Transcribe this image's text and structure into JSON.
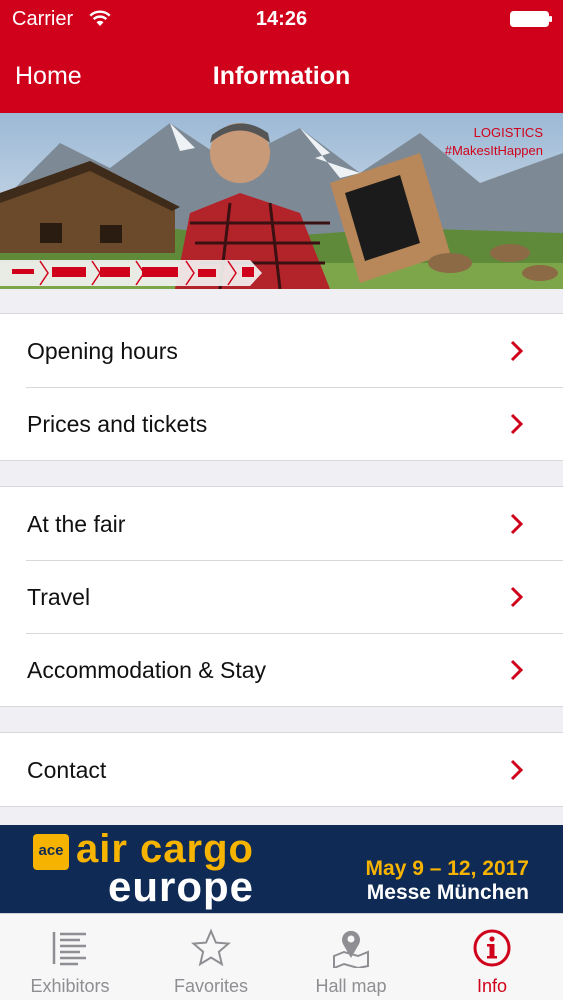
{
  "status_bar": {
    "carrier": "Carrier",
    "time": "14:26"
  },
  "nav": {
    "back_label": "Home",
    "title": "Information"
  },
  "banner": {
    "tag_line1": "LOGISTICS",
    "tag_line2": "#MakesItHappen"
  },
  "groups": [
    {
      "items": [
        {
          "label": "Opening hours"
        },
        {
          "label": "Prices and tickets"
        }
      ]
    },
    {
      "items": [
        {
          "label": "At the fair"
        },
        {
          "label": "Travel"
        },
        {
          "label": "Accommodation & Stay"
        }
      ]
    },
    {
      "items": [
        {
          "label": "Contact"
        }
      ]
    }
  ],
  "ad": {
    "logo_mark": "ace",
    "brand_line1": "air cargo",
    "brand_line2": "europe",
    "date": "May 9 – 12, 2017",
    "venue": "Messe München"
  },
  "tabbar": {
    "tabs": [
      {
        "label": "Exhibitors",
        "icon": "list-icon",
        "active": false
      },
      {
        "label": "Favorites",
        "icon": "star-icon",
        "active": false
      },
      {
        "label": "Hall map",
        "icon": "map-pin-icon",
        "active": false
      },
      {
        "label": "Info",
        "icon": "info-icon",
        "active": true
      }
    ]
  },
  "colors": {
    "brand_red": "#d0021b",
    "ad_navy": "#0f2a55",
    "ad_yellow": "#f6b400"
  }
}
